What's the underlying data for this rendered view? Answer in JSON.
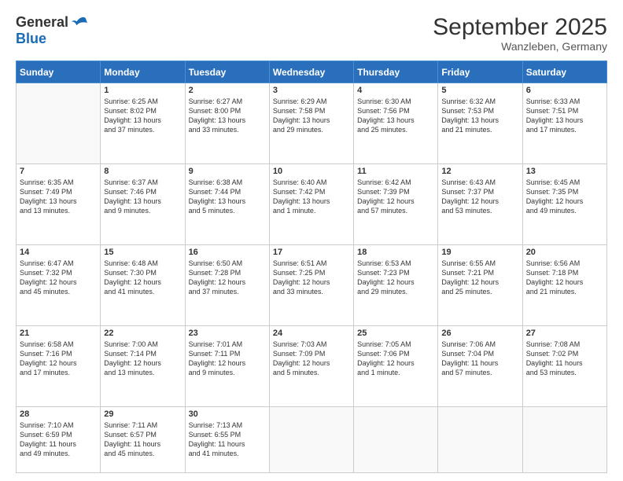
{
  "logo": {
    "general": "General",
    "blue": "Blue"
  },
  "title": "September 2025",
  "location": "Wanzleben, Germany",
  "days": [
    "Sunday",
    "Monday",
    "Tuesday",
    "Wednesday",
    "Thursday",
    "Friday",
    "Saturday"
  ],
  "weeks": [
    [
      {
        "day": "",
        "content": ""
      },
      {
        "day": "1",
        "content": "Sunrise: 6:25 AM\nSunset: 8:02 PM\nDaylight: 13 hours\nand 37 minutes."
      },
      {
        "day": "2",
        "content": "Sunrise: 6:27 AM\nSunset: 8:00 PM\nDaylight: 13 hours\nand 33 minutes."
      },
      {
        "day": "3",
        "content": "Sunrise: 6:29 AM\nSunset: 7:58 PM\nDaylight: 13 hours\nand 29 minutes."
      },
      {
        "day": "4",
        "content": "Sunrise: 6:30 AM\nSunset: 7:56 PM\nDaylight: 13 hours\nand 25 minutes."
      },
      {
        "day": "5",
        "content": "Sunrise: 6:32 AM\nSunset: 7:53 PM\nDaylight: 13 hours\nand 21 minutes."
      },
      {
        "day": "6",
        "content": "Sunrise: 6:33 AM\nSunset: 7:51 PM\nDaylight: 13 hours\nand 17 minutes."
      }
    ],
    [
      {
        "day": "7",
        "content": "Sunrise: 6:35 AM\nSunset: 7:49 PM\nDaylight: 13 hours\nand 13 minutes."
      },
      {
        "day": "8",
        "content": "Sunrise: 6:37 AM\nSunset: 7:46 PM\nDaylight: 13 hours\nand 9 minutes."
      },
      {
        "day": "9",
        "content": "Sunrise: 6:38 AM\nSunset: 7:44 PM\nDaylight: 13 hours\nand 5 minutes."
      },
      {
        "day": "10",
        "content": "Sunrise: 6:40 AM\nSunset: 7:42 PM\nDaylight: 13 hours\nand 1 minute."
      },
      {
        "day": "11",
        "content": "Sunrise: 6:42 AM\nSunset: 7:39 PM\nDaylight: 12 hours\nand 57 minutes."
      },
      {
        "day": "12",
        "content": "Sunrise: 6:43 AM\nSunset: 7:37 PM\nDaylight: 12 hours\nand 53 minutes."
      },
      {
        "day": "13",
        "content": "Sunrise: 6:45 AM\nSunset: 7:35 PM\nDaylight: 12 hours\nand 49 minutes."
      }
    ],
    [
      {
        "day": "14",
        "content": "Sunrise: 6:47 AM\nSunset: 7:32 PM\nDaylight: 12 hours\nand 45 minutes."
      },
      {
        "day": "15",
        "content": "Sunrise: 6:48 AM\nSunset: 7:30 PM\nDaylight: 12 hours\nand 41 minutes."
      },
      {
        "day": "16",
        "content": "Sunrise: 6:50 AM\nSunset: 7:28 PM\nDaylight: 12 hours\nand 37 minutes."
      },
      {
        "day": "17",
        "content": "Sunrise: 6:51 AM\nSunset: 7:25 PM\nDaylight: 12 hours\nand 33 minutes."
      },
      {
        "day": "18",
        "content": "Sunrise: 6:53 AM\nSunset: 7:23 PM\nDaylight: 12 hours\nand 29 minutes."
      },
      {
        "day": "19",
        "content": "Sunrise: 6:55 AM\nSunset: 7:21 PM\nDaylight: 12 hours\nand 25 minutes."
      },
      {
        "day": "20",
        "content": "Sunrise: 6:56 AM\nSunset: 7:18 PM\nDaylight: 12 hours\nand 21 minutes."
      }
    ],
    [
      {
        "day": "21",
        "content": "Sunrise: 6:58 AM\nSunset: 7:16 PM\nDaylight: 12 hours\nand 17 minutes."
      },
      {
        "day": "22",
        "content": "Sunrise: 7:00 AM\nSunset: 7:14 PM\nDaylight: 12 hours\nand 13 minutes."
      },
      {
        "day": "23",
        "content": "Sunrise: 7:01 AM\nSunset: 7:11 PM\nDaylight: 12 hours\nand 9 minutes."
      },
      {
        "day": "24",
        "content": "Sunrise: 7:03 AM\nSunset: 7:09 PM\nDaylight: 12 hours\nand 5 minutes."
      },
      {
        "day": "25",
        "content": "Sunrise: 7:05 AM\nSunset: 7:06 PM\nDaylight: 12 hours\nand 1 minute."
      },
      {
        "day": "26",
        "content": "Sunrise: 7:06 AM\nSunset: 7:04 PM\nDaylight: 11 hours\nand 57 minutes."
      },
      {
        "day": "27",
        "content": "Sunrise: 7:08 AM\nSunset: 7:02 PM\nDaylight: 11 hours\nand 53 minutes."
      }
    ],
    [
      {
        "day": "28",
        "content": "Sunrise: 7:10 AM\nSunset: 6:59 PM\nDaylight: 11 hours\nand 49 minutes."
      },
      {
        "day": "29",
        "content": "Sunrise: 7:11 AM\nSunset: 6:57 PM\nDaylight: 11 hours\nand 45 minutes."
      },
      {
        "day": "30",
        "content": "Sunrise: 7:13 AM\nSunset: 6:55 PM\nDaylight: 11 hours\nand 41 minutes."
      },
      {
        "day": "",
        "content": ""
      },
      {
        "day": "",
        "content": ""
      },
      {
        "day": "",
        "content": ""
      },
      {
        "day": "",
        "content": ""
      }
    ]
  ]
}
